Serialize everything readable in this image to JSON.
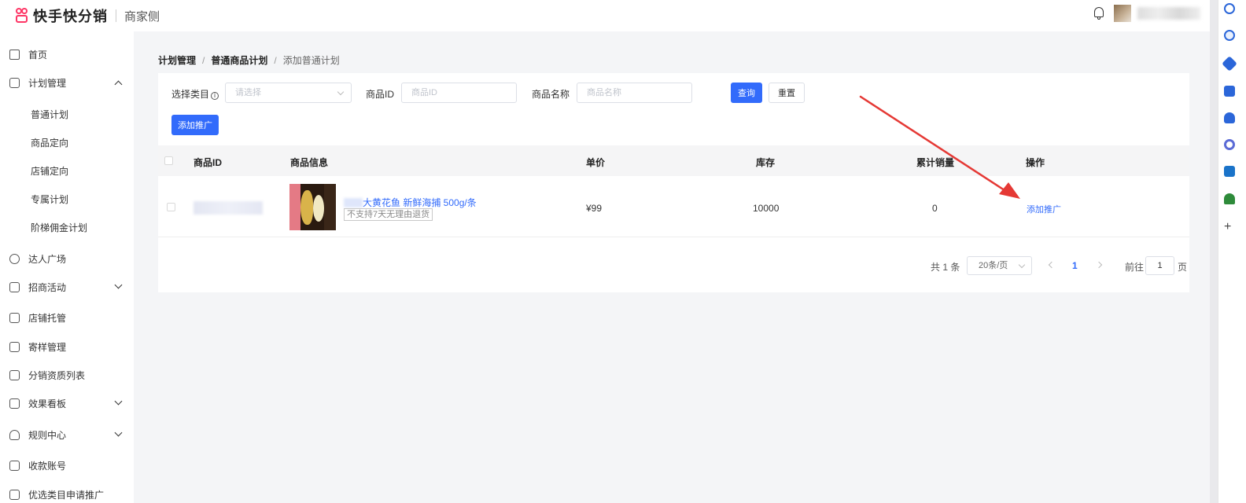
{
  "header": {
    "app_name": "快手快分销",
    "sub_title": "商家侧"
  },
  "sidebar": {
    "items": [
      {
        "label": "首页"
      },
      {
        "label": "计划管理"
      },
      {
        "label": "普通计划"
      },
      {
        "label": "商品定向"
      },
      {
        "label": "店铺定向"
      },
      {
        "label": "专属计划"
      },
      {
        "label": "阶梯佣金计划"
      },
      {
        "label": "达人广场"
      },
      {
        "label": "招商活动"
      },
      {
        "label": "店铺托管"
      },
      {
        "label": "寄样管理"
      },
      {
        "label": "分销资质列表"
      },
      {
        "label": "效果看板"
      },
      {
        "label": "规则中心"
      },
      {
        "label": "收款账号"
      },
      {
        "label": "优选类目申请推广"
      }
    ]
  },
  "breadcrumb": {
    "level1": "计划管理",
    "level2": "普通商品计划",
    "level3": "添加普通计划",
    "separator": "/"
  },
  "filters": {
    "category_label": "选择类目",
    "category_info": "i",
    "category_placeholder": "请选择",
    "id_label": "商品ID",
    "id_placeholder": "商品ID",
    "name_label": "商品名称",
    "name_placeholder": "商品名称",
    "query_button": "查询",
    "reset_button": "重置",
    "add_button": "添加推广"
  },
  "table": {
    "headers": [
      "商品ID",
      "商品信息",
      "单价",
      "库存",
      "累计销量",
      "操作"
    ],
    "rows": [
      {
        "title": "大黄花鱼 新鲜海捕 500g/条",
        "tag": "不支持7天无理由退货",
        "price": "¥99",
        "stock": "10000",
        "sales": "0",
        "action": "添加推广"
      }
    ]
  },
  "pagination": {
    "total": "共 1 条",
    "page_size": "20条/页",
    "current_page": "1",
    "goto_label": "前往",
    "goto_value": "1",
    "page_suffix": "页"
  },
  "colors": {
    "primary": "#326bfb",
    "annotation_arrow": "#e53935"
  }
}
